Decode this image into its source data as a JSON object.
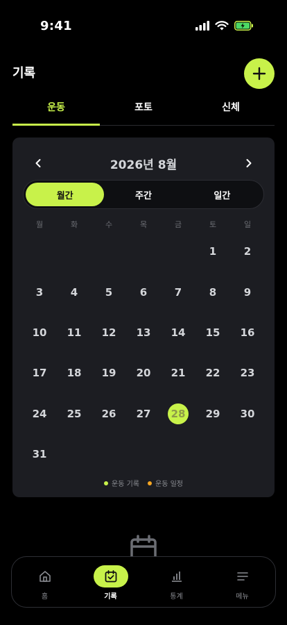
{
  "status_bar": {
    "time": "9:41",
    "icons": [
      "signal-icon",
      "wifi-icon",
      "battery-icon"
    ]
  },
  "header": {
    "title": "기록",
    "add_icon": "plus-icon"
  },
  "tabs": [
    {
      "label": "운동",
      "active": true
    },
    {
      "label": "포토",
      "active": false
    },
    {
      "label": "신체",
      "active": false
    }
  ],
  "calendar": {
    "month_title": "2026년 8월",
    "view_modes": [
      {
        "label": "월간",
        "active": true
      },
      {
        "label": "주간",
        "active": false
      },
      {
        "label": "일간",
        "active": false
      }
    ],
    "weekdays": [
      "월",
      "화",
      "수",
      "목",
      "금",
      "토",
      "일"
    ],
    "leading_blanks": 5,
    "days": [
      "1",
      "2",
      "3",
      "4",
      "5",
      "6",
      "7",
      "8",
      "9",
      "10",
      "11",
      "12",
      "13",
      "14",
      "15",
      "16",
      "17",
      "18",
      "19",
      "20",
      "21",
      "22",
      "23",
      "24",
      "25",
      "26",
      "27",
      "28",
      "29",
      "30",
      "31"
    ],
    "selected_day": "28",
    "legend": [
      {
        "label": "운동 기록",
        "color": "#c8f24a"
      },
      {
        "label": "운동 일정",
        "color": "#f5a623"
      }
    ]
  },
  "bottom_nav": [
    {
      "label": "홈",
      "icon": "home-icon",
      "active": false
    },
    {
      "label": "기록",
      "icon": "calendar-check-icon",
      "active": true
    },
    {
      "label": "통계",
      "icon": "bar-chart-icon",
      "active": false
    },
    {
      "label": "메뉴",
      "icon": "menu-icon",
      "active": false
    }
  ],
  "colors": {
    "accent": "#c8f24a",
    "card": "#1c1d22",
    "background": "#000000"
  }
}
